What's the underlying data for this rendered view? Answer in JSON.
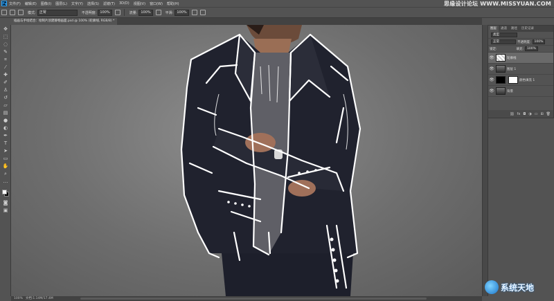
{
  "app": {
    "logo_text": "Ps"
  },
  "menu": [
    "文件(F)",
    "编辑(E)",
    "图像(I)",
    "图层(L)",
    "文字(Y)",
    "选择(S)",
    "滤镜(T)",
    "3D(D)",
    "视图(V)",
    "窗口(W)",
    "帮助(H)"
  ],
  "watermark_top": "思缘设计论坛 WWW.MISSYUAN.COM",
  "options": {
    "mode_label": "模式:",
    "mode_value": "正常",
    "opacity_label": "不透明度:",
    "opacity_value": "100%",
    "flow_label": "流量:",
    "flow_value": "100%",
    "smooth_label": "平滑:",
    "smooth_value": "100%"
  },
  "document_tab": "插画与手绘结合：绘制片创建静物画面.psd @ 100% (轮廓线, RGB/8) *",
  "status": {
    "zoom": "100%",
    "doc_info": "文档:1.14M/17.4M"
  },
  "layers_panel": {
    "tabs": [
      "图层",
      "通道",
      "路径",
      "历史记录"
    ],
    "kind_label": "类型",
    "blend_mode": "正常",
    "opacity_label": "不透明度:",
    "opacity_value": "100%",
    "lock_label": "锁定:",
    "fill_label": "填充:",
    "fill_value": "100%",
    "layers": [
      {
        "name": "轮廓线"
      },
      {
        "name": "图层 1"
      },
      {
        "name": "颜色填充 1"
      },
      {
        "name": "背景"
      }
    ],
    "footer_icons": [
      "link-icon",
      "fx-icon",
      "mask-icon",
      "adjustment-icon",
      "group-icon",
      "new-layer-icon",
      "trash-icon"
    ]
  },
  "watermark_bottom": "系统天地",
  "colors": {
    "ui_bg": "#535353",
    "panel_dark": "#424242",
    "selected_layer": "#6a6a6a",
    "ps_blue": "#31a8ff"
  }
}
